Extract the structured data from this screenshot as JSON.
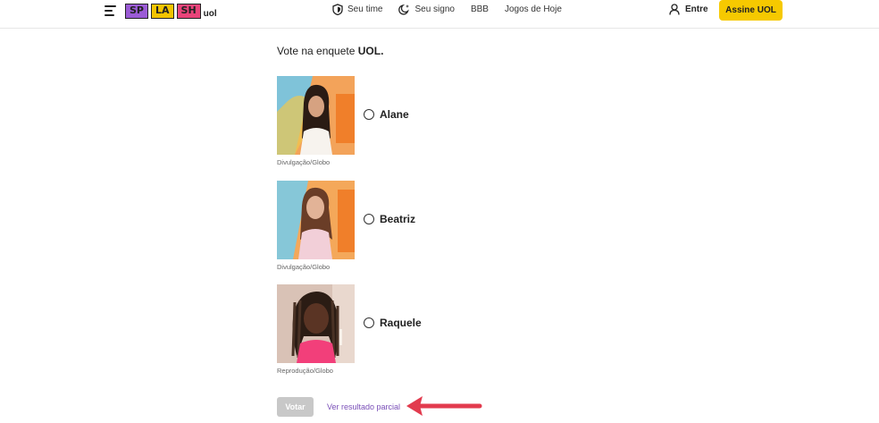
{
  "header": {
    "logo_blocks": [
      "SP",
      "LA",
      "SH"
    ],
    "logo_suffix": "uol",
    "nav": [
      {
        "label": "Seu time",
        "icon": "shield-icon"
      },
      {
        "label": "Seu signo",
        "icon": "moon-star-icon"
      },
      {
        "label": "BBB",
        "icon": ""
      },
      {
        "label": "Jogos de Hoje",
        "icon": ""
      }
    ],
    "login_label": "Entre",
    "subscribe_label": "Assine UOL"
  },
  "poll": {
    "title_prefix": "Vote na enquete ",
    "title_brand": "UOL.",
    "options": [
      {
        "name": "Alane",
        "credit": "Divulgação/Globo"
      },
      {
        "name": "Beatriz",
        "credit": "Divulgação/Globo"
      },
      {
        "name": "Raquele",
        "credit": "Reprodução/Globo"
      }
    ],
    "vote_label": "Votar",
    "partial_label": "Ver resultado parcial"
  },
  "colors": {
    "accent_yellow": "#f6c900",
    "link_purple": "#7a4fb8",
    "arrow_red": "#e23b4e"
  }
}
